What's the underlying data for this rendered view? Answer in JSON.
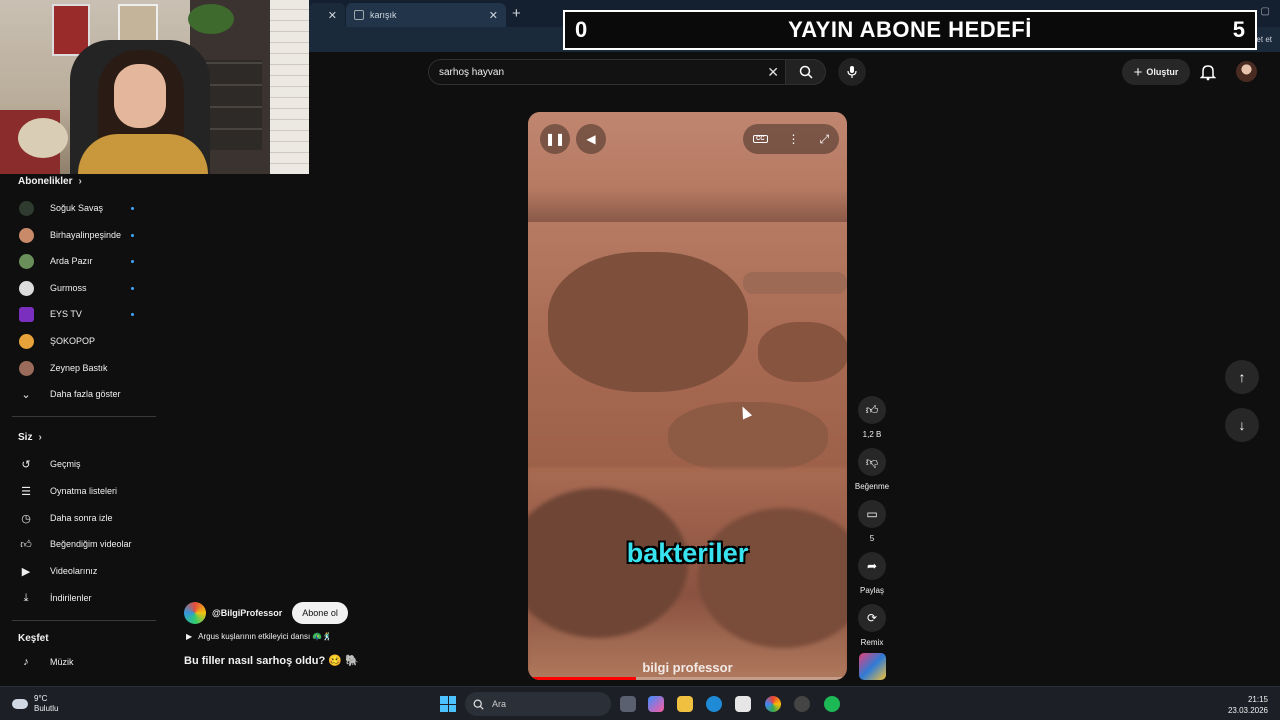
{
  "browser": {
    "tab2_title": "karışık",
    "tab_close": "✕",
    "new_tab": "+",
    "copilot_label": "Sohbet et"
  },
  "overlay": {
    "current": "0",
    "title": "YAYIN ABONE HEDEFİ",
    "target": "5"
  },
  "search": {
    "query": "sarhoş hayvan",
    "clear": "✕"
  },
  "header": {
    "create_label": "Oluştur"
  },
  "sidebar": {
    "subscriptions_title": "Abonelikler",
    "subscriptions": [
      {
        "label": "Soğuk Savaş",
        "avatar_color": "#2f3b2f"
      },
      {
        "label": "Birhayalinpeşinde",
        "avatar_color": "#c98a6a"
      },
      {
        "label": "Arda Pazır",
        "avatar_color": "#6b8f5a"
      },
      {
        "label": "Gurmoss",
        "avatar_color": "#dcdcdc"
      },
      {
        "label": "EYS TV",
        "avatar_color": "#7a2fbf"
      },
      {
        "label": "ŞOKOPOP",
        "avatar_color": "#e8a23a"
      },
      {
        "label": "Zeynep Bastık",
        "avatar_color": "#9a6b5a"
      }
    ],
    "show_more": "Daha fazla göster",
    "you_title": "Siz",
    "you_items": [
      {
        "label": "Geçmiş",
        "icon": "history-icon"
      },
      {
        "label": "Oynatma listeleri",
        "icon": "playlists-icon"
      },
      {
        "label": "Daha sonra izle",
        "icon": "watch-later-icon"
      },
      {
        "label": "Beğendiğim videolar",
        "icon": "like-icon"
      },
      {
        "label": "Videolarınız",
        "icon": "your-videos-icon"
      },
      {
        "label": "İndirilenler",
        "icon": "download-icon"
      }
    ],
    "explore_title": "Keşfet",
    "explore_items": [
      {
        "label": "Müzik",
        "icon": "music-icon"
      }
    ]
  },
  "video": {
    "caption": "bakteriler",
    "watermark": "bilgi professor",
    "progress": 0.34
  },
  "actions": {
    "likes": "1,2 B",
    "dislike_label": "Beğenme",
    "comments": "5",
    "share_label": "Paylaş",
    "remix_label": "Remix"
  },
  "channel": {
    "handle": "@BilgiProfessor",
    "subscribe_label": "Abone ol",
    "music": "Argus kuşlarının etkileyici dansı 🦚🕺",
    "title": "Bu filler nasıl sarhoş oldu? 🥴 🐘"
  },
  "taskbar": {
    "temp": "9°C",
    "weather": "Bulutlu",
    "search_placeholder": "Ara",
    "time": "21:15",
    "date": "23.03.2026"
  }
}
